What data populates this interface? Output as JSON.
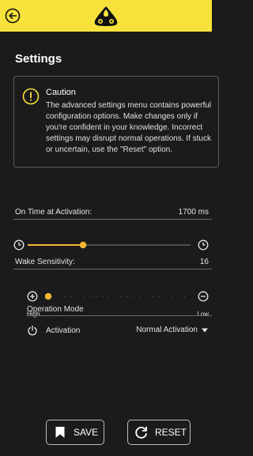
{
  "header": {
    "back_icon": "back-arrow-circle-icon",
    "logo_icon": "brand-logo-icon"
  },
  "page": {
    "title": "Settings"
  },
  "caution": {
    "icon": "warning-circle-icon",
    "title": "Caution",
    "body": "The advanced settings menu contains powerful\nconfiguration options. Make changes only if\nyou're confident in your knowledge. Incorrect\nsettings may disrupt normal operations. If stuck\nor uncertain, use the \"Reset\" option."
  },
  "on_time": {
    "label": "On Time at Activation:",
    "value": "1700 ms",
    "slider_fraction": 0.34,
    "left_icon": "clock-icon",
    "right_icon": "clock-icon"
  },
  "wake": {
    "label": "Wake Sensitivity:",
    "value": "16",
    "slider_fraction": 0.0,
    "left_icon": "plus-circle-icon",
    "right_icon": "minus-circle-icon",
    "high_label": "High",
    "low_label": "Low"
  },
  "mode": {
    "label": "Operation Mode",
    "activation_icon": "power-icon",
    "activation_label": "Activation",
    "selected": "Normal Activation"
  },
  "buttons": {
    "save": "SAVE",
    "reset": "RESET"
  },
  "colors": {
    "accent": "#f6e23a",
    "slider": "#f5b731",
    "background": "#1b1b1b"
  }
}
